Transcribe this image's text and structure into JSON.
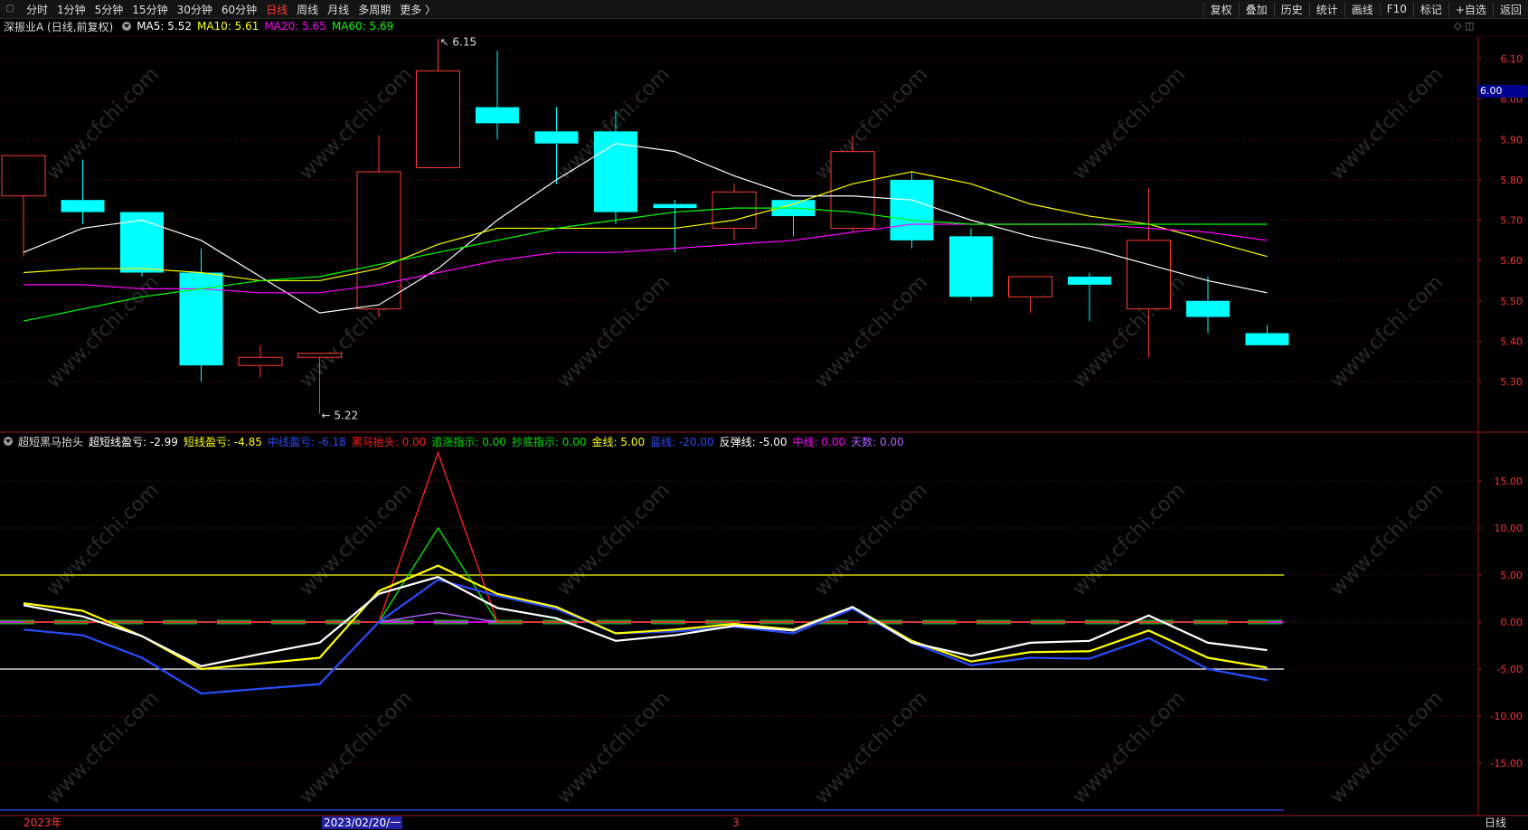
{
  "toolbar": {
    "left": [
      "分时",
      "1分钟",
      "5分钟",
      "15分钟",
      "30分钟",
      "60分钟",
      "日线",
      "周线",
      "月线",
      "多周期",
      "更多 〉"
    ],
    "active": "日线",
    "right": [
      "复权",
      "叠加",
      "历史",
      "统计",
      "画线",
      "F10",
      "标记",
      "+自选",
      "返回"
    ]
  },
  "main_info": {
    "title": "深振业A (日线,前复权)",
    "ma5": "MA5: 5.52",
    "ma10": "MA10: 5.61",
    "ma20": "MA20: 5.65",
    "ma60": "MA60: 5.69",
    "colors": {
      "ma5": "#ffffff",
      "ma10": "#ffff00",
      "ma20": "#ff00ff",
      "ma60": "#00ff00"
    }
  },
  "indicator_info": {
    "name": "超短黑马抬头",
    "items": [
      {
        "text": "超短线盈亏: -2.99",
        "color": "#ffffff"
      },
      {
        "text": "短线盈亏: -4.85",
        "color": "#ffff00"
      },
      {
        "text": "中线盈亏: -6.18",
        "color": "#2a4dff"
      },
      {
        "text": "黑马抬头: 0.00",
        "color": "#ff2020"
      },
      {
        "text": "追涨指示: 0.00",
        "color": "#00e000"
      },
      {
        "text": "抄底指示: 0.00",
        "color": "#00e000"
      },
      {
        "text": "金线: 5.00",
        "color": "#ffff00"
      },
      {
        "text": "蓝线: -20.00",
        "color": "#2a4dff"
      },
      {
        "text": "反弹线: -5.00",
        "color": "#ffffff"
      },
      {
        "text": "中线: 0.00",
        "color": "#ff00ff"
      },
      {
        "text": "天数: 0.00",
        "color": "#b060ff"
      }
    ]
  },
  "price_axis": {
    "ticks": [
      "6.10",
      "6.00",
      "5.90",
      "5.80",
      "5.70",
      "5.60",
      "5.50",
      "5.40",
      "5.30"
    ],
    "current": "6.00"
  },
  "indicator_axis": {
    "ticks": [
      "15.00",
      "10.00",
      "5.00",
      "0.00",
      "-5.00",
      "-10.00",
      "-15.00"
    ]
  },
  "annotations": {
    "high": "6.15",
    "low": "5.22"
  },
  "xaxis": {
    "year": "2023年",
    "cursor_date": "2023/02/20/一",
    "marker": "3",
    "period": "日线"
  },
  "chart_data": [
    {
      "type": "candlestick",
      "ylim": [
        5.22,
        6.15
      ],
      "candles": [
        {
          "o": 5.76,
          "h": 5.86,
          "l": 5.61,
          "c": 5.86
        },
        {
          "o": 5.75,
          "h": 5.85,
          "l": 5.69,
          "c": 5.72
        },
        {
          "o": 5.72,
          "h": 5.72,
          "l": 5.56,
          "c": 5.57
        },
        {
          "o": 5.57,
          "h": 5.63,
          "l": 5.3,
          "c": 5.34
        },
        {
          "o": 5.34,
          "h": 5.39,
          "l": 5.31,
          "c": 5.36
        },
        {
          "o": 5.36,
          "h": 5.37,
          "l": 5.22,
          "c": 5.37
        },
        {
          "o": 5.48,
          "h": 5.91,
          "l": 5.46,
          "c": 5.82
        },
        {
          "o": 5.83,
          "h": 6.15,
          "l": 5.83,
          "c": 6.07
        },
        {
          "o": 5.98,
          "h": 6.12,
          "l": 5.9,
          "c": 5.94
        },
        {
          "o": 5.92,
          "h": 5.98,
          "l": 5.79,
          "c": 5.89
        },
        {
          "o": 5.92,
          "h": 5.97,
          "l": 5.69,
          "c": 5.72
        },
        {
          "o": 5.74,
          "h": 5.75,
          "l": 5.62,
          "c": 5.73
        },
        {
          "o": 5.68,
          "h": 5.79,
          "l": 5.65,
          "c": 5.77
        },
        {
          "o": 5.75,
          "h": 5.75,
          "l": 5.66,
          "c": 5.71
        },
        {
          "o": 5.68,
          "h": 5.91,
          "l": 5.67,
          "c": 5.87
        },
        {
          "o": 5.8,
          "h": 5.82,
          "l": 5.63,
          "c": 5.65
        },
        {
          "o": 5.66,
          "h": 5.68,
          "l": 5.5,
          "c": 5.51
        },
        {
          "o": 5.51,
          "h": 5.56,
          "l": 5.47,
          "c": 5.56
        },
        {
          "o": 5.56,
          "h": 5.57,
          "l": 5.45,
          "c": 5.54
        },
        {
          "o": 5.48,
          "h": 5.78,
          "l": 5.36,
          "c": 5.65
        },
        {
          "o": 5.5,
          "h": 5.56,
          "l": 5.42,
          "c": 5.46
        },
        {
          "o": 5.42,
          "h": 5.44,
          "l": 5.39,
          "c": 5.39
        }
      ],
      "series": [
        {
          "name": "MA5",
          "color": "#ffffff",
          "values": [
            5.62,
            5.68,
            5.7,
            5.65,
            5.56,
            5.47,
            5.49,
            5.58,
            5.7,
            5.8,
            5.89,
            5.87,
            5.81,
            5.76,
            5.76,
            5.75,
            5.7,
            5.66,
            5.63,
            5.59,
            5.55,
            5.52
          ]
        },
        {
          "name": "MA10",
          "color": "#ffff00",
          "values": [
            5.57,
            5.58,
            5.58,
            5.57,
            5.55,
            5.55,
            5.58,
            5.64,
            5.68,
            5.68,
            5.68,
            5.68,
            5.7,
            5.74,
            5.79,
            5.82,
            5.79,
            5.74,
            5.71,
            5.69,
            5.65,
            5.61
          ]
        },
        {
          "name": "MA20",
          "color": "#ff00ff",
          "values": [
            5.54,
            5.54,
            5.53,
            5.53,
            5.52,
            5.52,
            5.54,
            5.57,
            5.6,
            5.62,
            5.62,
            5.63,
            5.64,
            5.65,
            5.67,
            5.69,
            5.69,
            5.69,
            5.69,
            5.68,
            5.67,
            5.65
          ]
        },
        {
          "name": "MA60",
          "color": "#00ff00",
          "values": [
            5.45,
            5.48,
            5.51,
            5.53,
            5.55,
            5.56,
            5.59,
            5.62,
            5.65,
            5.68,
            5.7,
            5.72,
            5.73,
            5.73,
            5.72,
            5.7,
            5.69,
            5.69,
            5.69,
            5.69,
            5.69,
            5.69
          ]
        }
      ]
    },
    {
      "type": "line",
      "ylim": [
        -20,
        18
      ],
      "series": [
        {
          "name": "超短线盈亏",
          "color": "#ffffff",
          "values": [
            1.8,
            0.6,
            -1.5,
            -4.7,
            -3.4,
            -2.2,
            3.0,
            4.8,
            1.5,
            0.4,
            -2.0,
            -1.4,
            -0.4,
            -0.9,
            1.6,
            -2.2,
            -3.6,
            -2.2,
            -2.0,
            0.7,
            -2.2,
            -2.99
          ]
        },
        {
          "name": "短线盈亏",
          "color": "#ffff00",
          "values": [
            2.0,
            1.2,
            -1.5,
            -5.0,
            -4.4,
            -3.8,
            3.3,
            6.0,
            3.0,
            1.6,
            -1.2,
            -0.8,
            -0.2,
            -0.8,
            1.6,
            -2.0,
            -4.2,
            -3.2,
            -3.1,
            -0.9,
            -3.8,
            -4.85
          ]
        },
        {
          "name": "中线盈亏",
          "color": "#2a4dff",
          "values": [
            -0.8,
            -1.4,
            -3.8,
            -7.6,
            -7.1,
            -6.6,
            0.0,
            4.5,
            2.8,
            1.4,
            -1.2,
            -1.0,
            -0.5,
            -1.2,
            1.4,
            -2.2,
            -4.6,
            -3.8,
            -3.9,
            -1.7,
            -5.0,
            -6.18
          ]
        },
        {
          "name": "黑马抬头",
          "color": "#ff2020",
          "values": [
            0,
            0,
            0,
            0,
            0,
            0,
            0,
            18,
            0,
            0,
            0,
            0,
            0,
            0,
            0,
            0,
            0,
            0,
            0,
            0,
            0,
            0
          ]
        },
        {
          "name": "追涨指示",
          "color": "#00e000",
          "values": [
            0,
            0,
            0,
            0,
            0,
            0,
            0,
            10,
            0,
            0,
            0,
            0,
            0,
            0,
            0,
            0,
            0,
            0,
            0,
            0,
            0,
            0
          ]
        },
        {
          "name": "天数",
          "color": "#b060ff",
          "values": [
            0,
            0,
            0,
            0,
            0,
            0,
            0,
            1,
            0,
            0,
            0,
            0,
            0,
            0,
            0,
            0,
            0,
            0,
            0,
            0,
            0,
            0
          ]
        }
      ],
      "hlines": [
        {
          "name": "金线",
          "value": 5,
          "color": "#ffff00"
        },
        {
          "name": "反弹线",
          "value": -5,
          "color": "#ffffff"
        },
        {
          "name": "蓝线",
          "value": -20,
          "color": "#2a4dff"
        },
        {
          "name": "中线",
          "value": 0,
          "color": "#ff00ff"
        }
      ]
    }
  ],
  "watermark": "www.cfchi.com"
}
